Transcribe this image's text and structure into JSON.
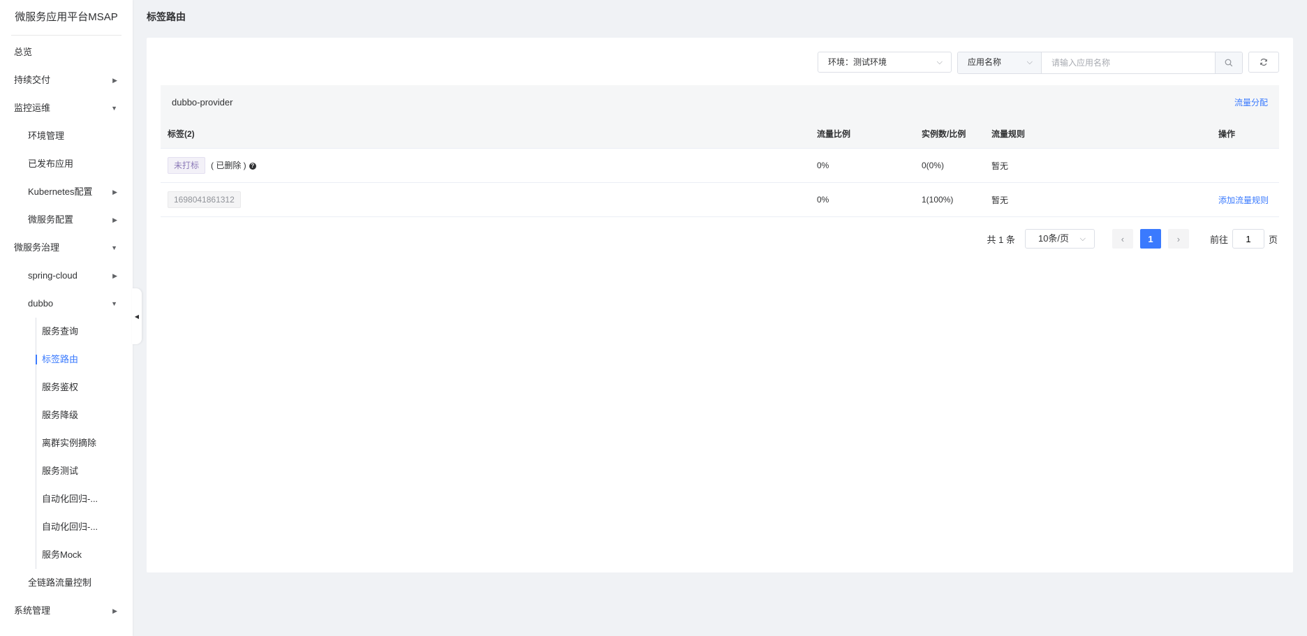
{
  "app": {
    "title": "微服务应用平台MSAP"
  },
  "page": {
    "title": "标签路由"
  },
  "sidebar": {
    "items": [
      {
        "label": "总览"
      },
      {
        "label": "持续交付"
      },
      {
        "label": "监控运维"
      },
      {
        "label": "环境管理"
      },
      {
        "label": "已发布应用"
      },
      {
        "label": "Kubernetes配置"
      },
      {
        "label": "微服务配置"
      },
      {
        "label": "微服务治理"
      },
      {
        "label": "spring-cloud"
      },
      {
        "label": "dubbo"
      },
      {
        "label": "服务查询"
      },
      {
        "label": "标签路由"
      },
      {
        "label": "服务鉴权"
      },
      {
        "label": "服务降级"
      },
      {
        "label": "离群实例摘除"
      },
      {
        "label": "服务测试"
      },
      {
        "label": "自动化回归-..."
      },
      {
        "label": "自动化回归-..."
      },
      {
        "label": "服务Mock"
      },
      {
        "label": "全链路流量控制"
      },
      {
        "label": "系统管理"
      }
    ]
  },
  "toolbar": {
    "env_label": "环境：测试环境",
    "search_type": "应用名称",
    "search_placeholder": "请输入应用名称"
  },
  "group": {
    "name": "dubbo-provider",
    "action": "流量分配"
  },
  "table": {
    "columns": [
      "标签(2)",
      "流量比例",
      "实例数/比例",
      "流量规则",
      "操作"
    ],
    "rows": [
      {
        "tag": "未打标",
        "note": "( 已删除 )",
        "ratio": "0%",
        "instances": "0(0%)",
        "rule": "暂无",
        "action": ""
      },
      {
        "tag": "1698041861312",
        "note": "",
        "ratio": "0%",
        "instances": "1(100%)",
        "rule": "暂无",
        "action": "添加流量规则"
      }
    ]
  },
  "pagination": {
    "total_text": "共 1 条",
    "page_size": "10条/页",
    "current_page": "1",
    "goto_label": "前往",
    "goto_value": "1",
    "page_suffix": "页"
  },
  "colors": {
    "accent": "#3a7afe",
    "background": "#f0f2f5",
    "tag_purple": "#8c7ab8"
  }
}
